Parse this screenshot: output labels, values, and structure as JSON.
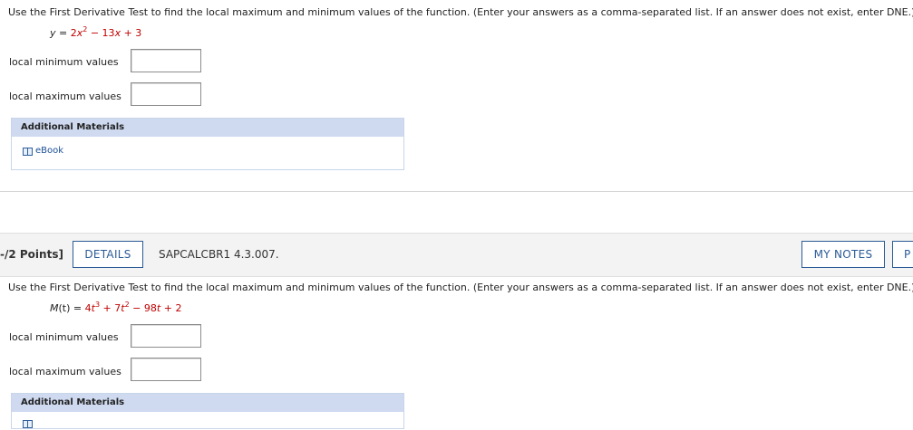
{
  "question1": {
    "prompt": "Use the First Derivative Test to find the local maximum and minimum values of the function. (Enter your answers as a comma-separated list. If an answer does not exist, enter DNE.)",
    "equation": {
      "lhs": "y",
      "eq": " = ",
      "c1": "2",
      "var1": "x",
      "exp1": "2",
      "t2": " − 13",
      "var2": "x",
      "t3": " + 3"
    },
    "min_label": "local minimum values",
    "min_value": "",
    "max_label": "local maximum values",
    "max_value": "",
    "materials_title": "Additional Materials",
    "ebook_label": "eBook"
  },
  "question2": {
    "points": "-/2 Points]",
    "details_button": "DETAILS",
    "question_id": "SAPCALCBR1 4.3.007.",
    "my_notes_button": "MY NOTES",
    "next_button_partial": "P",
    "prompt": "Use the First Derivative Test to find the local maximum and minimum values of the function. (Enter your answers as a comma-separated list. If an answer does not exist, enter DNE.)",
    "equation": {
      "lhs": "M",
      "arg": "(t)",
      "eq": " = ",
      "c1": "4",
      "var1": "t",
      "exp1": "3",
      "t2": " + 7",
      "var2": "t",
      "exp2": "2",
      "t3": " − 98",
      "var3": "t",
      "t4": " + 2"
    },
    "min_label": "local minimum values",
    "min_value": "",
    "max_label": "local maximum values",
    "max_value": "",
    "materials_title": "Additional Materials"
  },
  "colors": {
    "link": "#1a4f95",
    "accent_red": "#c00000",
    "button_border": "#2b5b97",
    "materials_header": "#cfdaf0"
  }
}
